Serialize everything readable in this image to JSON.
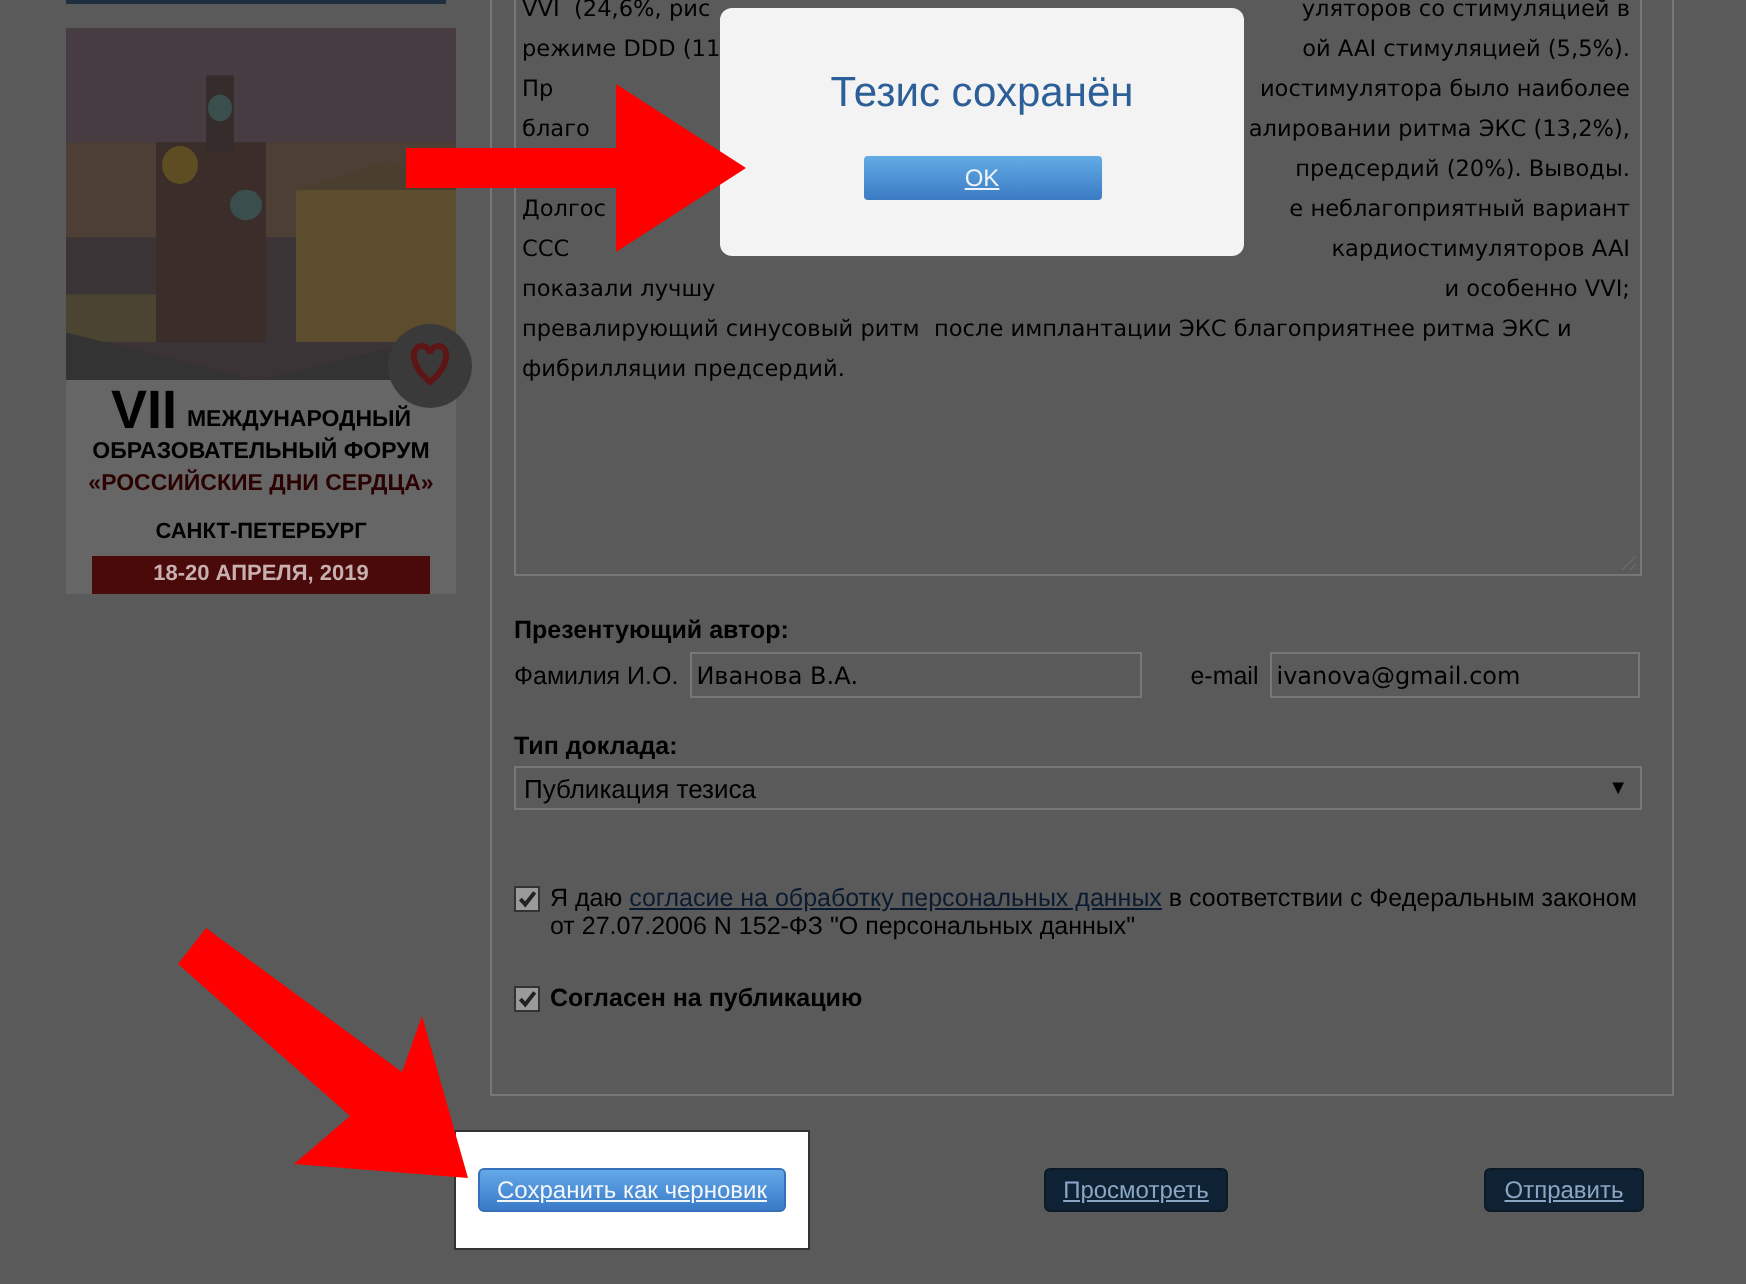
{
  "poster": {
    "numeral": "VII",
    "line_1": "МЕЖДУНАРОДНЫЙ",
    "line_2": "ОБРАЗОВАТЕЛЬНЫЙ ФОРУМ",
    "title": "«РОССИЙСКИЕ ДНИ СЕРДЦА»",
    "city": "САНКТ-ПЕТЕРБУРГ",
    "dates": "18-20 АПРЕЛЯ, 2019"
  },
  "form": {
    "abstract_lines": [
      {
        "left": "VVI  (24,6%, рис",
        "right": "уляторов со стимуляцией в"
      },
      {
        "left": "режиме DDD (11",
        "right": "ой AAI стимуляцией (5,5%)."
      },
      {
        "left": "Пр",
        "right": "иостимулятора было наиболее"
      },
      {
        "left": "благо",
        "right": "алировании ритма ЭКС (13,2%),"
      },
      {
        "right": "предсердий (20%). Выводы."
      },
      {
        "left": "Долгос",
        "right": "е неблагоприятный вариант"
      },
      {
        "left": "ССС",
        "right": "кардиостимуляторов AAI"
      },
      {
        "left": "показали лучшу",
        "right": "и особенно VVI;"
      },
      {
        "left": "превалирующий синусовый ритм  после имплантации ЭКС благоприятнее ритма ЭКС и"
      },
      {
        "left": "фибрилляции предсердий."
      }
    ],
    "presenter": {
      "heading": "Презентующий автор:",
      "name_label": "Фамилия И.О.",
      "name_value": "Иванова В.А.",
      "email_label": "e-mail",
      "email_value": "ivanova@gmail.com"
    },
    "report_type": {
      "label": "Тип доклада:",
      "value": "Публикация тезиса",
      "arrow": "▼"
    },
    "consents": [
      {
        "checked": true,
        "bold": false,
        "before": "Я даю ",
        "link": "согласие на обработку персональных данных",
        "after": " в соответствии с Федеральным законом от 27.07.2006 N 152-ФЗ \"О персональных данных\""
      },
      {
        "checked": true,
        "bold": true,
        "before": "Согласен на публикацию"
      }
    ]
  },
  "buttons": [
    {
      "label": "Сохранить как черновик",
      "highlighted": true
    },
    {
      "label": "Просмотреть",
      "highlighted": false
    },
    {
      "label": "Отправить",
      "highlighted": false
    }
  ],
  "modal": {
    "title": "Тезис сохранён",
    "button": "OK"
  }
}
